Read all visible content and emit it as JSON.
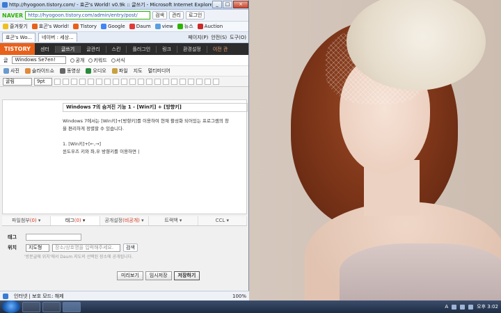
{
  "window": {
    "title": "http://hyogoon.tistory.com/ - 효곤's World! v0.9k :: 글쓰기 - Microsoft Internet Explorer",
    "controls": [
      "_",
      "□",
      "×"
    ]
  },
  "addressbar": {
    "brand": "NAVER",
    "url": "http://hyogoon.tistory.com/admin/entry/post/",
    "search": "검색",
    "manage": "관리",
    "login": "로그인"
  },
  "favorites": {
    "label": "즐겨찾기",
    "items": [
      "효곤's World!",
      "Tistory",
      "Google",
      "Daum",
      "view",
      "뉴스",
      "Auction"
    ]
  },
  "tabs": {
    "items": [
      "효곤's Wo...",
      "네이버 : 세상..."
    ],
    "tools": [
      "페이지(P)",
      "안전(S)",
      "도구(O)"
    ]
  },
  "tistory_menu": {
    "logo": "TISTORY",
    "items": [
      "센터",
      "글쓰기",
      "글관리",
      "스킨",
      "플러그인",
      "링크",
      "환경설정"
    ],
    "active": "글쓰기",
    "right": "이전 관"
  },
  "category": {
    "prefix": "글",
    "selected": "Windows Se7en!",
    "options": [
      "공개",
      "키워드",
      "서식"
    ]
  },
  "attach": [
    "사진",
    "슬라이드쇼",
    "동영상",
    "오디오",
    "파일",
    "지도",
    "멀티미디어"
  ],
  "format": {
    "font": "굴림",
    "size": "9pt"
  },
  "editor": {
    "post_title": "Windows 7의 숨겨진 기능 1 - [Win키] + [방향키]",
    "body_lines": [
      "Windows 7에서는 [Win키]+[방향키]를 이용하여 현재 활성화 되어있는 프로그램의 창",
      "을 편리하게 정렬할 수 있습니다.",
      "",
      "1. [Win키]+[←,→]",
      "윈도우즈 키와 좌,우 방향키를 이용하면 |"
    ]
  },
  "bottom_tabs": [
    {
      "label": "파일첨부",
      "count": "(0)"
    },
    {
      "label": "태그",
      "count": "(0)"
    },
    {
      "label": "공개설정",
      "count": "(비공개)"
    },
    {
      "label": "트랙백",
      "count": ""
    },
    {
      "label": "CCL",
      "count": ""
    }
  ],
  "tag": {
    "tag_label": "태그",
    "location_label": "위치",
    "location_select": "지도형",
    "location_placeholder": "장소/상호명을 입력해주세요.",
    "search_button": "검색",
    "note": "'방문글에 위치'에서 Daum 지도의 선택된 장소에 공개됩니다."
  },
  "actions": {
    "preview": "미리보기",
    "temp_save": "임시저장",
    "save": "저장하기"
  },
  "statusbar": {
    "zone": "인터넷 | 보호 모드: 해제",
    "zoom": "100%"
  },
  "taskbar": {
    "ime": "A",
    "time": "오후 3:02"
  },
  "colors": {
    "naver_green": "#2db400",
    "tistory_orange": "#e8611a",
    "menu_dark": "#2c2c2c"
  }
}
